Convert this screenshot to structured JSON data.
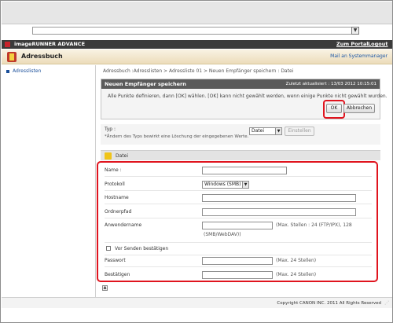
{
  "browser": {
    "dropdown_arrow": "▼"
  },
  "brand": {
    "title": "imageRUNNER ADVANCE",
    "portal_link": "Zum Portal",
    "logout_link": "Logout"
  },
  "app": {
    "title": "Adressbuch",
    "sysmgr_link": "Mail an Systemmanager"
  },
  "sidebar": {
    "items": [
      {
        "label": "Adresslisten"
      }
    ]
  },
  "breadcrumb": "Adressbuch :Adresslisten > Adressliste 01 > Neuen Empfänger speichern : Datei",
  "panel": {
    "title": "Neuen Empfänger speichern",
    "updated": "Zuletzt aktualisiert : 13/03 2012 10:15:01",
    "text": "Alle Punkte definieren, dann [OK] wählen. [OK] kann nicht gewählt werden, wenn einige Punkte nicht gewählt wurden.",
    "ok_label": "OK",
    "cancel_label": "Abbrechen"
  },
  "typ": {
    "label": "Typ :",
    "note": "*Ändern des Typs bewirkt eine Löschung der eingegebenen Werte.",
    "selected": "Datei",
    "set_label": "Einstellen"
  },
  "section": {
    "title": "Datei"
  },
  "form": {
    "name_label": "Name :",
    "protocol_label": "Protokoll",
    "protocol_value": "Windows (SMB)",
    "host_label": "Hostname",
    "folder_label": "Ordnerpfad",
    "user_label": "Anwendername",
    "user_note": "(Max. Stellen : 24 (FTP/IPX), 128",
    "user_note2": "(SMB/WebDAV))",
    "confirm_label": "Vor Senden bestätigen",
    "password_label": "Passwort",
    "password_note": "(Max. 24 Stellen)",
    "confirm_pw_label": "Bestätigen",
    "confirm_pw_note": "(Max. 24 Stellen)"
  },
  "footer": {
    "copyright": "Copyright CANON INC. 2011 All Rights Reserved"
  },
  "colors": {
    "highlight": "#e0141e",
    "brandbar": "#3b3b3b",
    "panel_header": "#5a5a5a",
    "link": "#1a55a5"
  }
}
